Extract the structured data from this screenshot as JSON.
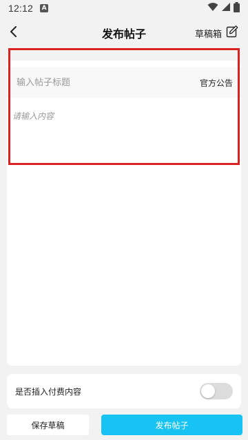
{
  "status_bar": {
    "time": "12:12",
    "app_icon_letter": "A"
  },
  "header": {
    "title": "发布帖子",
    "drafts_label": "草稿箱"
  },
  "editor": {
    "title_placeholder": "输入帖子标题",
    "category_tag": "官方公告",
    "content_placeholder": "请输入内容"
  },
  "paid_content": {
    "label": "是否插入付费内容",
    "enabled": false
  },
  "actions": {
    "save_draft_label": "保存草稿",
    "publish_label": "发布帖子"
  },
  "colors": {
    "accent": "#17c3f3",
    "highlight": "#d92121",
    "background": "#f2f2f2"
  }
}
